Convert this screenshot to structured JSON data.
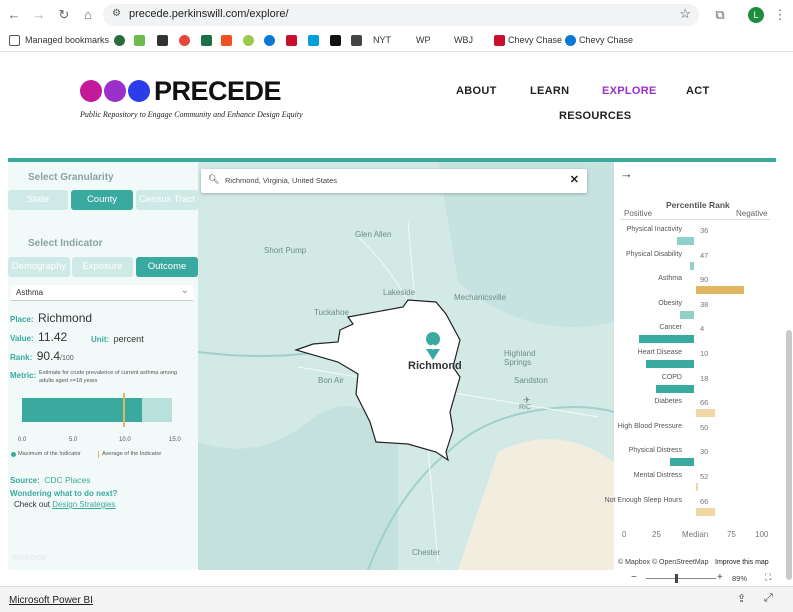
{
  "browser": {
    "url": "precede.perkinswill.com/explore/",
    "profile_initial": "L"
  },
  "bookmarks": {
    "managed": "Managed bookmarks",
    "nyt": "NYT",
    "wp": "WP",
    "wbj": "WBJ",
    "chevy1": "Chevy Chase",
    "chevy2": "Chevy Chase"
  },
  "site": {
    "logo": "PRECEDE",
    "tagline": "Public Repository to Engage Community and Enhance Design Equity",
    "nav": {
      "about": "ABOUT",
      "learn": "LEARN",
      "explore": "EXPLORE",
      "act": "ACT",
      "resources": "RESOURCES"
    },
    "colors": {
      "teal": "#3aa99f",
      "purple": "#9b2fc9",
      "magenta": "#c3199b",
      "blue": "#2b3de8"
    }
  },
  "left_panel": {
    "granularity_title": "Select Granularity",
    "granularity_options": [
      "State",
      "County",
      "Census Tract"
    ],
    "indicator_title": "Select Indicator",
    "indicator_options": [
      "Demography",
      "Exposure",
      "Outcome"
    ],
    "dropdown_value": "Asthma",
    "place_label": "Place:",
    "place_value": "Richmond",
    "value_label": "Value:",
    "value": "11.42",
    "unit_label": "Unit:",
    "unit": "percent",
    "rank_label": "Rank:",
    "rank": "90.4",
    "rank_denominator": "/100",
    "metric_label": "Metric:",
    "metric_text": "Estimate for crude prevalence of current asthma among adults aged >=18 years",
    "gauge": {
      "value": 11.42,
      "max_of_indicator": 12.0,
      "average": 10.1,
      "axis_max": 15
    },
    "gauge_ticks": [
      "0.0",
      "5.0",
      "10.0",
      "15.0"
    ],
    "legend_max": "Maximum of the Indicator",
    "legend_avg": "Average of the Indicator",
    "source_label": "Source:",
    "source_link": "CDC Places",
    "wondering": "Wondering what to do next?",
    "check_out": "Check out",
    "design_link": "Design Strategies",
    "mapbox_logo": "mapbox"
  },
  "map": {
    "search_value": "Richmond, Virginia, United States",
    "city_label": "Richmond",
    "places": [
      "Glen Allen",
      "Short Pump",
      "Lakeside",
      "Mechanicsville",
      "Tuckahoe",
      "Highland Springs",
      "Sandston",
      "Bon Air",
      "RIC",
      "Chester",
      "Sandston"
    ],
    "attribution": "© Mapbox © OpenStreetMap",
    "improve": "Improve this map"
  },
  "right_panel": {
    "title": "Percentile Rank",
    "positive": "Positive",
    "negative": "Negative",
    "rows": [
      {
        "label": "Physical Inactivity",
        "value": 36
      },
      {
        "label": "Physical Disability",
        "value": 47
      },
      {
        "label": "Asthma",
        "value": 90
      },
      {
        "label": "Obesity",
        "value": 38
      },
      {
        "label": "Cancer",
        "value": 4
      },
      {
        "label": "Heart Disease",
        "value": 10
      },
      {
        "label": "COPD",
        "value": 18
      },
      {
        "label": "Diabetes",
        "value": 66
      },
      {
        "label": "High Blood Pressure",
        "value": 50
      },
      {
        "label": "Physical Distress",
        "value": 30
      },
      {
        "label": "Mental Distress",
        "value": 52
      },
      {
        "label": "Not Enough Sleep Hours",
        "value": 66
      }
    ],
    "axis": [
      "0",
      "25",
      "Median",
      "75",
      "100"
    ]
  },
  "bottom": {
    "powerbi": "Microsoft Power BI",
    "zoom": "89%"
  }
}
